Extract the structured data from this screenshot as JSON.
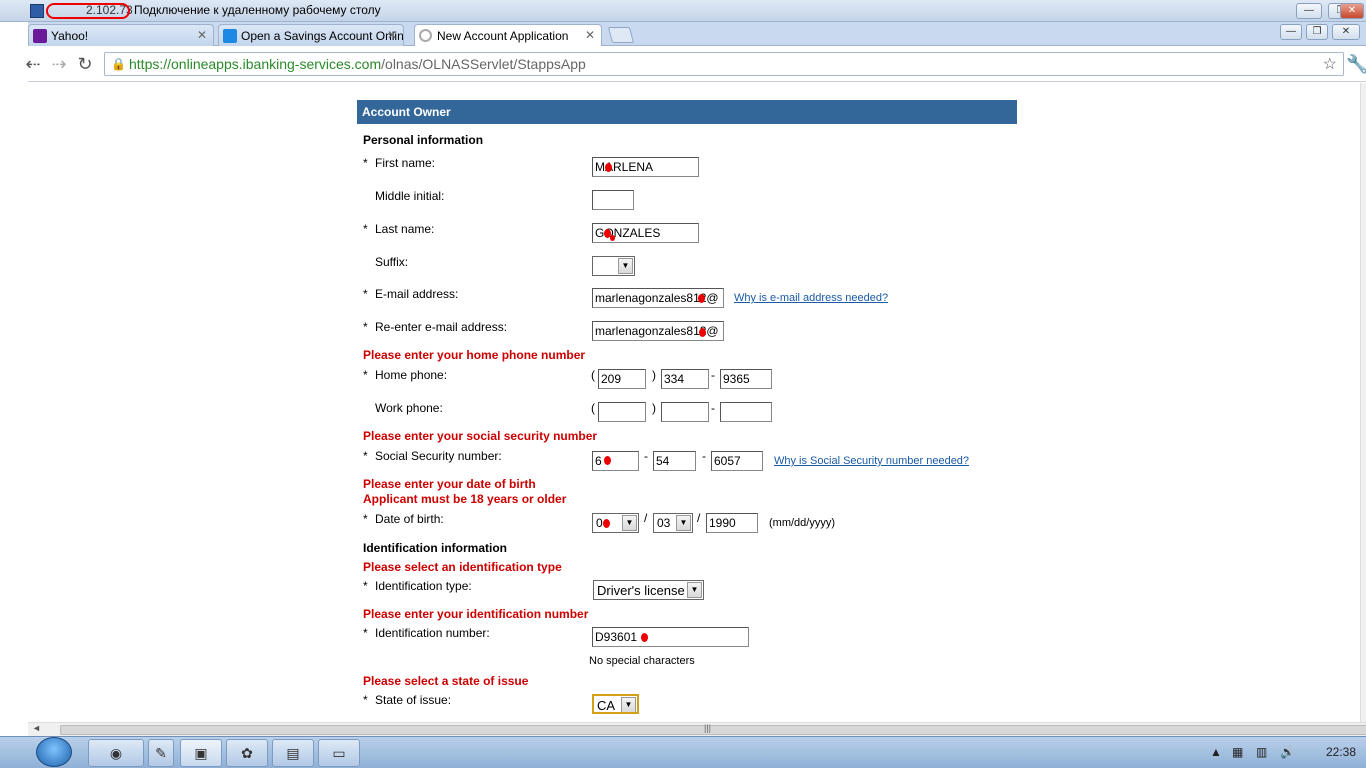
{
  "rdp": {
    "ip_text": "2.102.73",
    "title": "Подключение к удаленному рабочему столу"
  },
  "tabs": [
    {
      "label": "Yahoo!",
      "icon": "yahoo-icon",
      "active": false
    },
    {
      "label": "Open a Savings Account Onlin",
      "icon": "savings-site-icon",
      "active": false
    },
    {
      "label": "New Account Application",
      "icon": "loading-icon",
      "active": true
    }
  ],
  "address_bar": {
    "host": "https://onlineapps.ibanking-services.com",
    "path": "/olnas/OLNASServlet/StappsApp"
  },
  "form": {
    "section_title": "Account Owner",
    "personal_info_heading": "Personal information",
    "required_mark": "*",
    "first_name": {
      "label": "First name:",
      "value": "MARLENA"
    },
    "middle_initial": {
      "label": "Middle initial:",
      "value": ""
    },
    "last_name": {
      "label": "Last name:",
      "value": "GONZALES"
    },
    "suffix": {
      "label": "Suffix:",
      "value": ""
    },
    "email": {
      "label": "E-mail address:",
      "value": "marlenagonzales812@",
      "help_link": "Why is e-mail address needed?"
    },
    "email_confirm": {
      "label": "Re-enter e-mail address:",
      "value": "marlenagonzales812@"
    },
    "home_phone_error": "Please enter your home phone number",
    "home_phone": {
      "label": "Home phone:",
      "area": "209",
      "prefix": "334",
      "line": "9365"
    },
    "work_phone": {
      "label": "Work phone:",
      "area": "",
      "prefix": "",
      "line": ""
    },
    "ssn_error": "Please enter your social security number",
    "ssn": {
      "label": "Social Security number:",
      "part1": "6",
      "part2": "54",
      "part3": "6057",
      "help_link": "Why is Social Security number needed?"
    },
    "dob_error_1": "Please enter your date of birth",
    "dob_error_2": "Applicant must be 18 years or older",
    "dob": {
      "label": "Date of birth:",
      "month": "0",
      "day": "03",
      "year": "1990",
      "format_hint": "(mm/dd/yyyy)"
    },
    "id_info_heading": "Identification information",
    "id_type_error": "Please select an identification type",
    "id_type": {
      "label": "Identification type:",
      "value": "Driver's license"
    },
    "id_number_error": "Please enter your identification number",
    "id_number": {
      "label": "Identification number:",
      "value": "D93601",
      "hint": "No special characters"
    },
    "state_error": "Please select a state of issue",
    "state": {
      "label": "State of issue:",
      "value": "CA"
    }
  },
  "punctuation": {
    "open_paren": "(",
    "close_paren": ")",
    "dash": "-",
    "slash": "/"
  },
  "taskbar": {
    "clock": "22:38"
  },
  "colors": {
    "header_blue": "#336699",
    "error_red": "#cc0000",
    "link_blue": "#1a5aa6",
    "url_green": "#2a8a2a"
  }
}
